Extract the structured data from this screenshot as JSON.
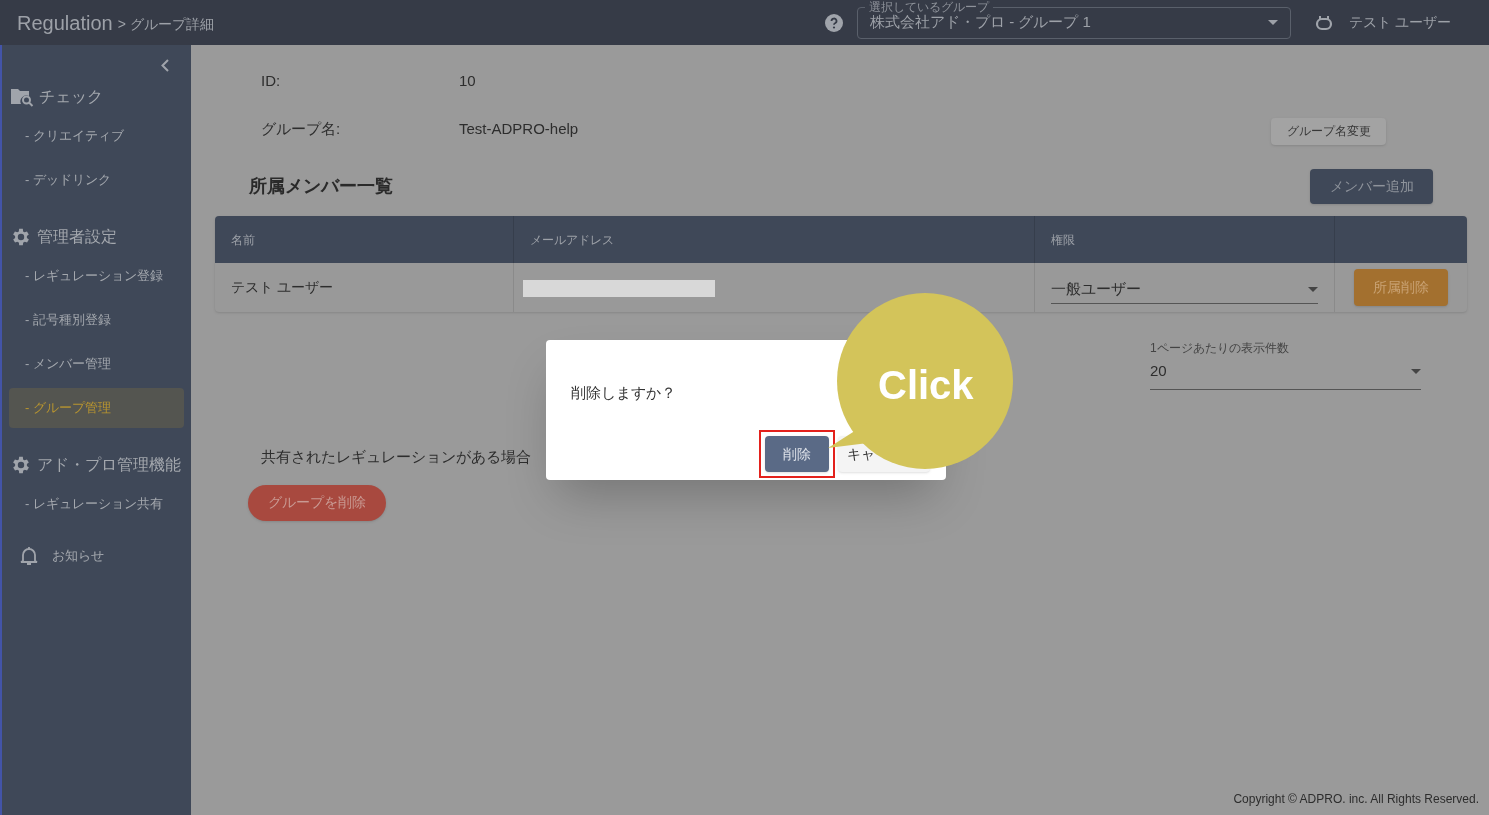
{
  "header": {
    "title": "Regulation",
    "breadcrumb": "> グループ詳細",
    "group_select": {
      "label": "選択しているグループ",
      "value": "株式会社アド・プロ - グループ 1"
    },
    "user": "テスト ユーザー"
  },
  "sidebar": {
    "sections": [
      {
        "title": "チェック",
        "items": [
          {
            "label": "- クリエイティブ",
            "selected": false
          },
          {
            "label": "- デッドリンク",
            "selected": false
          }
        ]
      },
      {
        "title": "管理者設定",
        "items": [
          {
            "label": "- レギュレーション登録",
            "selected": false
          },
          {
            "label": "- 記号種別登録",
            "selected": false
          },
          {
            "label": "- メンバー管理",
            "selected": false
          },
          {
            "label": "- グループ管理",
            "selected": true
          }
        ]
      },
      {
        "title": "アド・プロ管理機能",
        "items": [
          {
            "label": "- レギュレーション共有",
            "selected": false
          }
        ]
      }
    ],
    "notice": "お知らせ"
  },
  "detail": {
    "fields": [
      {
        "label": "ID:",
        "value": "10"
      },
      {
        "label": "グループ名:",
        "value": "Test-ADPRO-help"
      }
    ],
    "rename_button": "グループ名変更"
  },
  "members": {
    "title": "所属メンバー一覧",
    "add_button": "メンバー追加",
    "columns": [
      "名前",
      "メールアドレス",
      "権限"
    ],
    "rows": [
      {
        "name": "テスト ユーザー",
        "role": "一般ユーザー",
        "remove_button": "所属削除"
      }
    ]
  },
  "per_page": {
    "label": "1ページあたりの表示件数",
    "value": "20"
  },
  "shared_note": "共有されたレギュレーションがある場合",
  "delete_group_button": "グループを削除",
  "footer": "Copyright © ADPRO. inc. All Rights Reserved.",
  "dialog": {
    "message": "削除しますか？",
    "confirm_button": "削除",
    "cancel_button": "キャ"
  },
  "callout": {
    "text": "Click"
  }
}
